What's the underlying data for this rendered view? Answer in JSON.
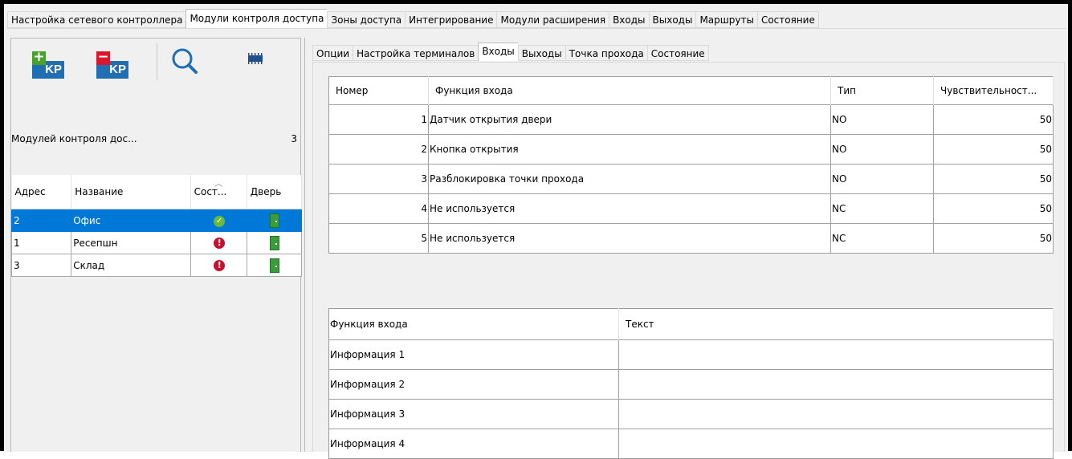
{
  "main_tabs": [
    {
      "label": "Настройка сетевого контроллера"
    },
    {
      "label": "Модули контроля доступа"
    },
    {
      "label": "Зоны доступа"
    },
    {
      "label": "Интегрирование"
    },
    {
      "label": "Модули расширения"
    },
    {
      "label": "Входы"
    },
    {
      "label": "Выходы"
    },
    {
      "label": "Маршруты"
    },
    {
      "label": "Состояние"
    }
  ],
  "toolbar": {
    "add_module_icon_text": "KP",
    "remove_module_icon_text": "KP",
    "icons": [
      "add-module-icon",
      "remove-module-icon",
      "search-icon",
      "module-board-icon"
    ]
  },
  "modules_count": {
    "label": "Модулей контроля дос...",
    "value": "3"
  },
  "module_list": {
    "columns": [
      "Адрес",
      "Название",
      "Сост...",
      "Дверь"
    ],
    "rows": [
      {
        "address": "2",
        "name": "Офис",
        "status": "ok",
        "selected": true
      },
      {
        "address": "1",
        "name": "Ресепшн",
        "status": "error",
        "selected": false
      },
      {
        "address": "3",
        "name": "Склад",
        "status": "error",
        "selected": false
      }
    ]
  },
  "sub_tabs": [
    {
      "label": "Опции"
    },
    {
      "label": "Настройка терминалов"
    },
    {
      "label": "Входы"
    },
    {
      "label": "Выходы"
    },
    {
      "label": "Точка прохода"
    },
    {
      "label": "Состояние"
    }
  ],
  "inputs_table": {
    "columns": [
      "Номер",
      "Функция входа",
      "Тип",
      "Чувствительност..."
    ],
    "rows": [
      {
        "number": "1",
        "function": "Датчик открытия двери",
        "type": "NO",
        "sensitivity": "50"
      },
      {
        "number": "2",
        "function": "Кнопка открытия",
        "type": "NO",
        "sensitivity": "50"
      },
      {
        "number": "3",
        "function": "Разблокировка точки прохода",
        "type": "NO",
        "sensitivity": "50"
      },
      {
        "number": "4",
        "function": "Не используется",
        "type": "NC",
        "sensitivity": "50"
      },
      {
        "number": "5",
        "function": "Не используется",
        "type": "NC",
        "sensitivity": "50"
      }
    ]
  },
  "info_table": {
    "columns": [
      "Функция входа",
      "Текст"
    ],
    "rows": [
      {
        "function": "Информация 1",
        "text": ""
      },
      {
        "function": "Информация 2",
        "text": ""
      },
      {
        "function": "Информация 3",
        "text": ""
      },
      {
        "function": "Информация 4",
        "text": ""
      }
    ]
  },
  "colors": {
    "selection": "#0078d7",
    "status_ok": "#6cba3a",
    "status_error": "#c8102e",
    "door": "#3b9c3b",
    "kp_blue": "#1f6fb2"
  }
}
